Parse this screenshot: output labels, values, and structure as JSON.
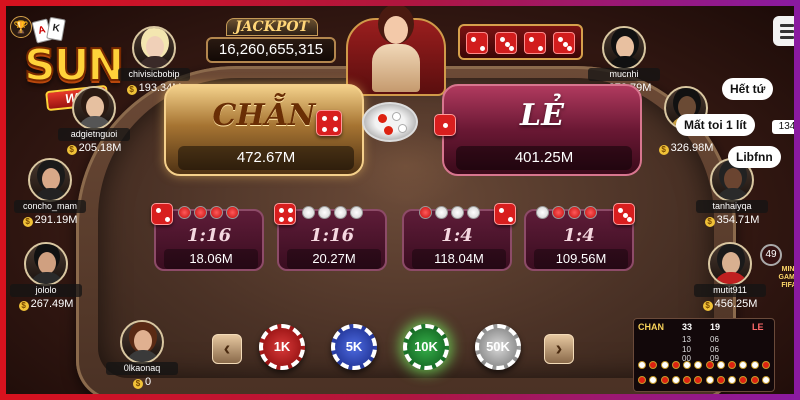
{
  "brand": {
    "logo_text": "SUN",
    "logo_sub": "Win",
    "logo_card_a": "A",
    "logo_card_k": "K"
  },
  "jackpot": {
    "title": "JACKPOT",
    "value": "16,260,655,315"
  },
  "main_bets": {
    "chan": {
      "label": "CHẴN",
      "amount": "472.67M"
    },
    "le": {
      "label": "LẺ",
      "amount": "401.25M"
    }
  },
  "sub_bets": [
    {
      "odds": "1:16",
      "amount": "18.06M",
      "combo": [
        "red",
        "red",
        "red",
        "red"
      ]
    },
    {
      "odds": "1:16",
      "amount": "20.27M",
      "combo": [
        "white",
        "white",
        "white",
        "white"
      ]
    },
    {
      "odds": "1:4",
      "amount": "118.04M",
      "combo": [
        "red",
        "white",
        "white",
        "white"
      ]
    },
    {
      "odds": "1:4",
      "amount": "109.56M",
      "combo": [
        "white",
        "red",
        "red",
        "red"
      ]
    }
  ],
  "chips": [
    {
      "label": "1K",
      "color": "#c41818"
    },
    {
      "label": "5K",
      "color": "#2a3fb0"
    },
    {
      "label": "10K",
      "color": "#1e8a30",
      "selected": true
    },
    {
      "label": "50K",
      "color": "#9a9a9a"
    }
  ],
  "players_left": [
    {
      "name": "chivisicbobip",
      "balance": "193.34M"
    },
    {
      "name": "adgietnguoi",
      "balance": "205.18M"
    },
    {
      "name": "concho_mam",
      "balance": "291.19M"
    },
    {
      "name": "jololo",
      "balance": "267.49M"
    },
    {
      "name": "0lkaonaq",
      "balance": "0"
    }
  ],
  "players_right": [
    {
      "name": "mucnhi",
      "balance": "273.79M"
    },
    {
      "name": "",
      "balance": "326.98M"
    },
    {
      "name": "tanhaiyqa",
      "balance": "354.71M"
    },
    {
      "name": "mutit911",
      "balance": "456.25M"
    }
  ],
  "chat": [
    {
      "text": "Hết tứ"
    },
    {
      "text": "Mất toi 1 lít"
    },
    {
      "text": "Libfnn"
    }
  ],
  "side": {
    "count": "134",
    "badge": "49",
    "mini_game": "MINI GAME",
    "mini_game_sub": "FIFA"
  },
  "history": {
    "chan_label": "CHAN",
    "chan_total": "33",
    "le_total": "19",
    "le_label": "LE",
    "counts": [
      "13",
      "06",
      "10",
      "06",
      "00",
      "09"
    ]
  },
  "colors": {
    "chan": "#c08a3e",
    "le": "#8a2346",
    "frame": "#d7121e"
  }
}
